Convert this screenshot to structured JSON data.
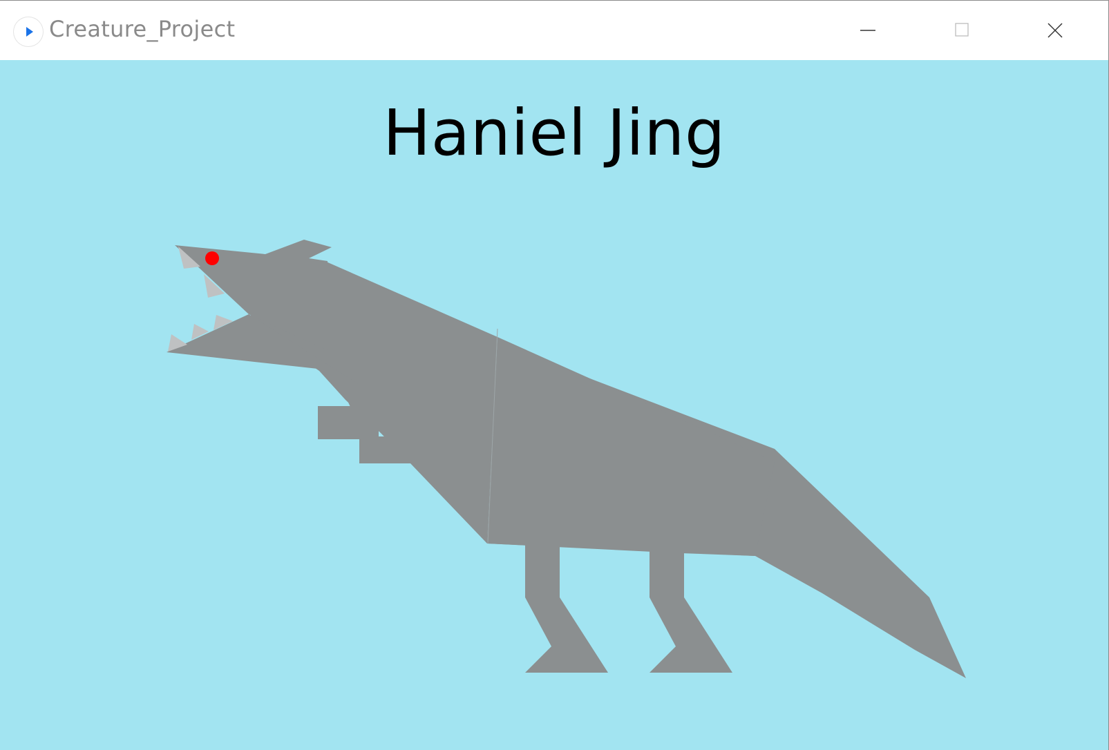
{
  "window": {
    "title": "Creature_Project",
    "app_icon": "play-icon",
    "controls": {
      "minimize": "minimize-icon",
      "maximize": "maximize-icon",
      "close": "close-icon"
    }
  },
  "canvas": {
    "heading": "Haniel Jing",
    "colors": {
      "background": "#a2e4f1",
      "body": "#8b8f90",
      "teeth": "#bfc1c2",
      "eye": "#ff0000",
      "text": "#000000"
    }
  }
}
